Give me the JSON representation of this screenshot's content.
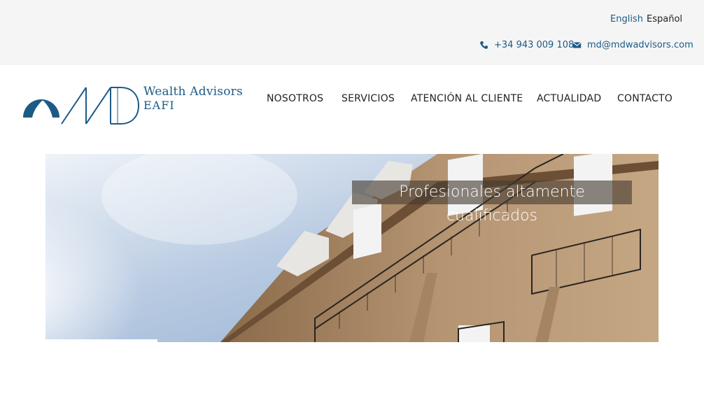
{
  "topbar": {
    "lang_en": "English",
    "lang_es": "Español",
    "phone": "+34 943 009 108",
    "email": "md@mdwadvisors.com",
    "phone_icon": "phone-icon",
    "email_icon": "envelope-icon"
  },
  "brand": {
    "monogram": "MD",
    "name": "Wealth Advisors",
    "subtitle": "EAFI",
    "color": "#1c5b86"
  },
  "nav": {
    "items": [
      "NOSOTROS",
      "SERVICIOS",
      "ATENCIÓN AL CLIENTE",
      "ACTUALIDAD",
      "CONTACTO"
    ]
  },
  "hero": {
    "caption": "Profesionales altamente cualificados"
  }
}
